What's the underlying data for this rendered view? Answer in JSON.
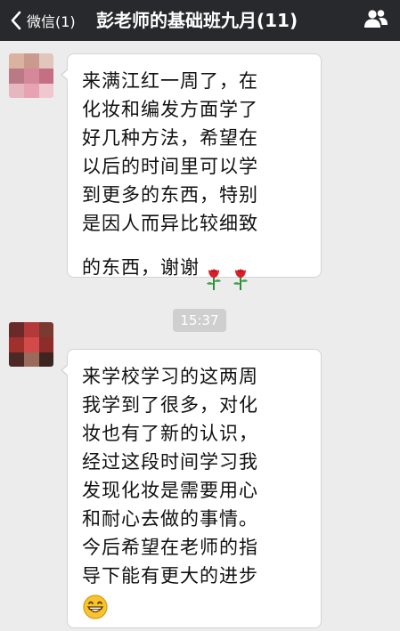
{
  "nav": {
    "back_label": "微信(1)",
    "title": "彭老师的基础班九月(11)"
  },
  "messages": [
    {
      "text": "来满江红一周了，在\n化妆和编发方面学了\n好几种方法，希望在\n以后的时间里可以学\n到更多的东西，特别\n是因人而异比较细致\n的东西，谢谢",
      "emoji": [
        "rose-icon",
        "rose-icon"
      ]
    },
    {
      "text": "来学校学习的这两周\n我学到了很多，对化\n妆也有了新的认识，\n经过这段时间学习我\n发现化妆是需要用心\n和耐心去做的事情。\n今后希望在老师的指\n导下能有更大的进步",
      "emoji": [
        "grinning-face-icon"
      ]
    }
  ],
  "timestamp": "15:37",
  "colors": {
    "nav_bg": "#28292d",
    "chat_bg": "#ececec",
    "bubble_bg": "#ffffff",
    "time_pill_bg": "#cfcfcf"
  }
}
